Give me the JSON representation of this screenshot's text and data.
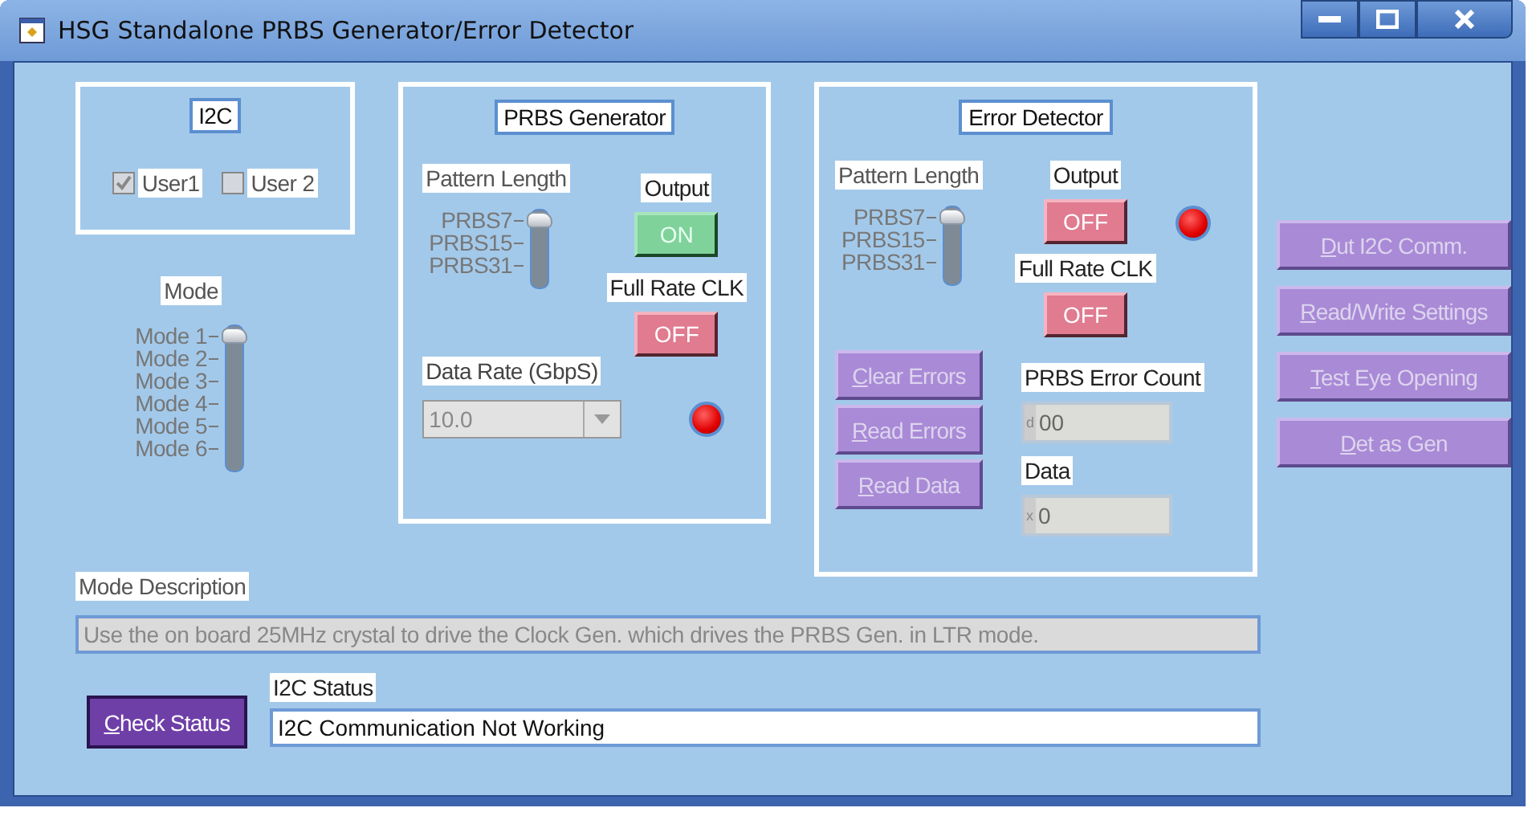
{
  "window": {
    "title": "HSG Standalone PRBS Generator/Error Detector"
  },
  "i2c": {
    "title": "I2C",
    "checkboxes": [
      {
        "label": "User1",
        "checked": true
      },
      {
        "label": "User 2",
        "checked": false
      }
    ]
  },
  "mode": {
    "label": "Mode",
    "options": [
      {
        "label": "Mode 1",
        "selected": true
      },
      {
        "label": "Mode 2",
        "selected": false
      },
      {
        "label": "Mode 3",
        "selected": false
      },
      {
        "label": "Mode 4",
        "selected": false
      },
      {
        "label": "Mode 5",
        "selected": false
      },
      {
        "label": "Mode 6",
        "selected": false
      }
    ]
  },
  "generator": {
    "title": "PRBS Generator",
    "pattern_length": {
      "label": "Pattern Length",
      "options": [
        {
          "label": "PRBS7",
          "selected": true
        },
        {
          "label": "PRBS15",
          "selected": false
        },
        {
          "label": "PRBS31",
          "selected": false
        }
      ]
    },
    "output": {
      "label": "Output",
      "button": "ON",
      "on": true
    },
    "full_rate_clk": {
      "label": "Full Rate CLK",
      "button": "OFF",
      "on": false
    },
    "data_rate": {
      "label": "Data Rate (GbpS)",
      "value": "10.0"
    },
    "led": {
      "lit": true
    }
  },
  "detector": {
    "title": "Error Detector",
    "pattern_length": {
      "label": "Pattern Length",
      "options": [
        {
          "label": "PRBS7",
          "selected": true
        },
        {
          "label": "PRBS15",
          "selected": false
        },
        {
          "label": "PRBS31",
          "selected": false
        }
      ]
    },
    "output": {
      "label": "Output",
      "button": "OFF",
      "on": false
    },
    "led": {
      "lit": true
    },
    "full_rate_clk": {
      "label": "Full Rate CLK",
      "button": "OFF",
      "on": false
    },
    "actions": [
      {
        "label": "Clear Errors",
        "disabled": true
      },
      {
        "label": "Read Errors",
        "disabled": true
      },
      {
        "label": "Read Data",
        "disabled": true
      }
    ],
    "error_count": {
      "label": "PRBS Error Count",
      "radix": "d",
      "value": "00"
    },
    "data": {
      "label": "Data",
      "radix": "x",
      "value": "0"
    }
  },
  "side_buttons": [
    {
      "label": "Dut I2C Comm.",
      "disabled": true
    },
    {
      "label": "Read/Write Settings",
      "disabled": true
    },
    {
      "label": "Test Eye Opening",
      "disabled": true
    },
    {
      "label": "Det as Gen",
      "disabled": true
    }
  ],
  "mode_description": {
    "label": "Mode Description",
    "value": "Use the on board 25MHz crystal to drive the Clock Gen. which drives the PRBS Gen. in LTR mode."
  },
  "check_status": {
    "label": "Check Status",
    "disabled": false
  },
  "i2c_status": {
    "label": "I2C Status",
    "value": "I2C Communication Not Working"
  }
}
